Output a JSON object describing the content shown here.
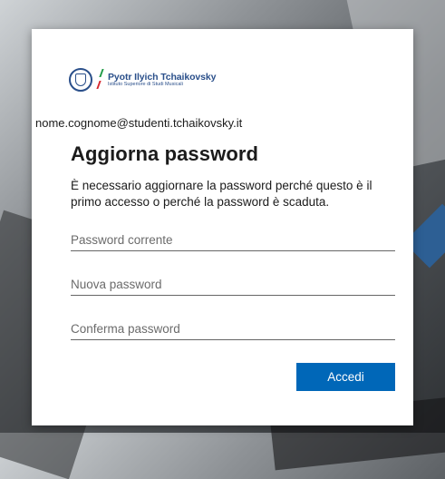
{
  "brand": {
    "name": "Pyotr Ilyich Tchaikovsky",
    "subtitle": "Istituto Superiore di Studi Musicali"
  },
  "identity": {
    "email": "nome.cognome@studenti.tchaikovsky.it"
  },
  "form": {
    "title": "Aggiorna password",
    "description": "È necessario aggiornare la password perché questo è il primo accesso o perché la password è scaduta.",
    "current_password_placeholder": "Password corrente",
    "new_password_placeholder": "Nuova password",
    "confirm_password_placeholder": "Conferma password",
    "submit_label": "Accedi"
  },
  "colors": {
    "accent": "#0067b8",
    "brand_blue": "#2a4f8a",
    "flag_green": "#1f9a45",
    "flag_red": "#d7282f"
  }
}
